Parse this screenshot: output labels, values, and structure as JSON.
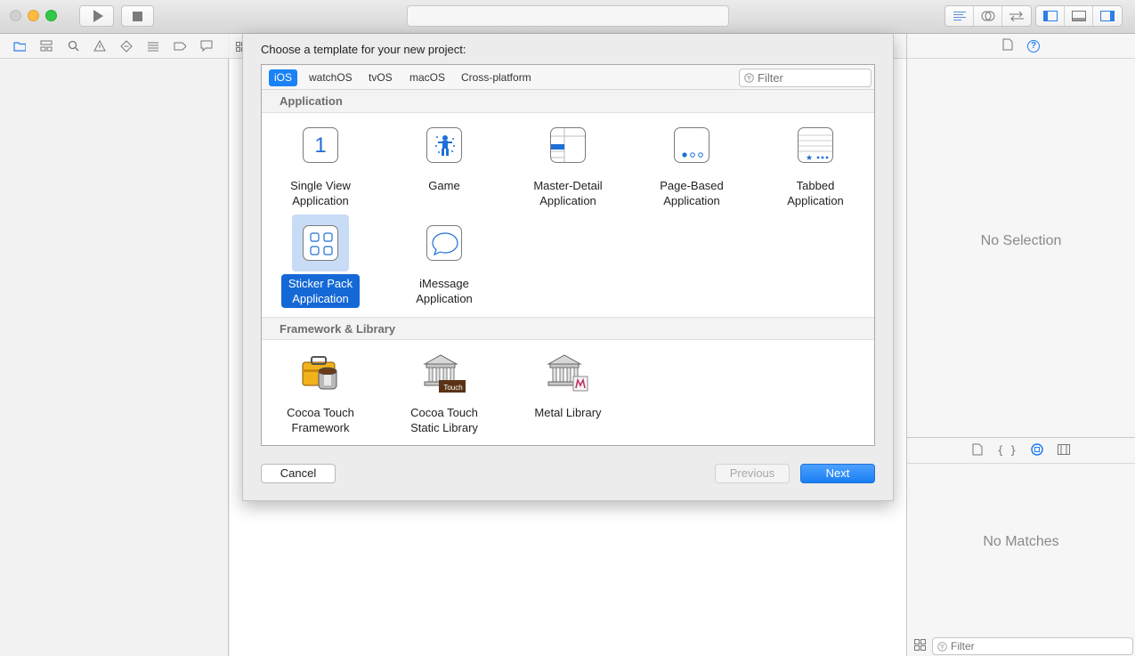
{
  "sheet": {
    "title": "Choose a template for your new project:",
    "platforms": [
      "iOS",
      "watchOS",
      "tvOS",
      "macOS",
      "Cross-platform"
    ],
    "active_platform": "iOS",
    "filter_placeholder": "Filter",
    "sections": [
      {
        "header": "Application",
        "templates": [
          {
            "line1": "Single View",
            "line2": "Application",
            "icon": "single-view-icon"
          },
          {
            "line1": "Game",
            "line2": "",
            "icon": "game-icon"
          },
          {
            "line1": "Master-Detail",
            "line2": "Application",
            "icon": "master-detail-icon"
          },
          {
            "line1": "Page-Based",
            "line2": "Application",
            "icon": "page-based-icon"
          },
          {
            "line1": "Tabbed",
            "line2": "Application",
            "icon": "tabbed-icon"
          },
          {
            "line1": "Sticker Pack",
            "line2": "Application",
            "icon": "sticker-pack-icon",
            "selected": true
          },
          {
            "line1": "iMessage",
            "line2": "Application",
            "icon": "imessage-icon"
          }
        ]
      },
      {
        "header": "Framework & Library",
        "templates": [
          {
            "line1": "Cocoa Touch",
            "line2": "Framework",
            "icon": "toolbox-icon"
          },
          {
            "line1": "Cocoa Touch",
            "line2": "Static Library",
            "icon": "library-building-icon",
            "badge": "Touch"
          },
          {
            "line1": "Metal Library",
            "line2": "",
            "icon": "metal-library-icon"
          }
        ]
      }
    ],
    "buttons": {
      "cancel": "Cancel",
      "previous": "Previous",
      "next": "Next"
    }
  },
  "inspector": {
    "empty_text": "No Selection",
    "library_empty_text": "No Matches",
    "library_filter_placeholder": "Filter"
  },
  "colors": {
    "accent": "#1a82f7",
    "selection": "#1569d6",
    "traffic_minimize": "#fdbc40",
    "traffic_zoom": "#34c84a"
  }
}
